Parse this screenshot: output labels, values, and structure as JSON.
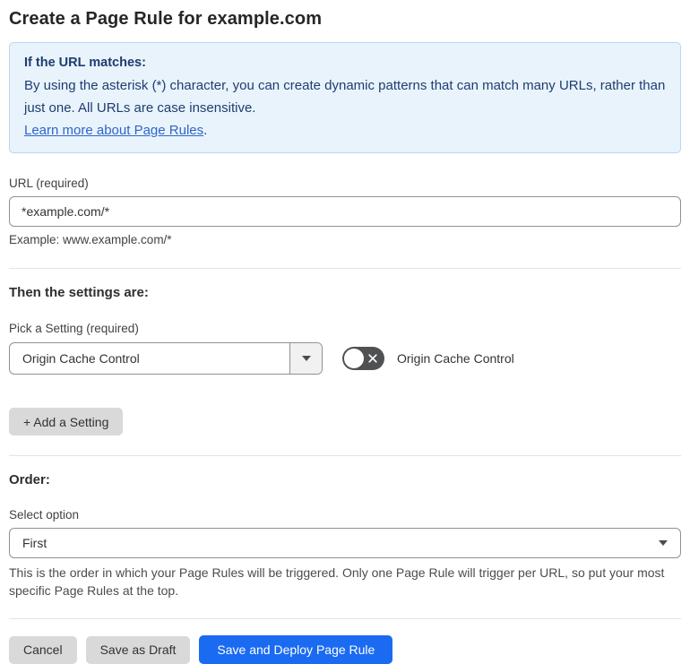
{
  "page": {
    "title": "Create a Page Rule for example.com"
  },
  "info_box": {
    "heading": "If the URL matches:",
    "body": "By using the asterisk (*) character, you can create dynamic patterns that can match many URLs, rather than just one. All URLs are case insensitive.",
    "link_label": "Learn more about Page Rules",
    "link_suffix": "."
  },
  "url_section": {
    "label": "URL (required)",
    "value": "*example.com/*",
    "example": "Example: www.example.com/*"
  },
  "settings_section": {
    "heading": "Then the settings are:",
    "picker_label": "Pick a Setting (required)",
    "picker_value": "Origin Cache Control",
    "toggle": {
      "label": "Origin Cache Control",
      "state": "off"
    },
    "add_setting_label": "+ Add a Setting"
  },
  "order_section": {
    "heading": "Order:",
    "select_label": "Select option",
    "select_value": "First",
    "helper": "This is the order in which your Page Rules will be triggered. Only one Page Rule will trigger per URL, so put your most specific Page Rules at the top."
  },
  "footer": {
    "cancel_label": "Cancel",
    "save_draft_label": "Save as Draft",
    "save_deploy_label": "Save and Deploy Page Rule"
  },
  "colors": {
    "accent_blue": "#1a6bf2",
    "info_bg": "#e9f3fc",
    "info_border": "#b5d8f4",
    "info_text": "#1e3d6f",
    "link_blue": "#2e65c9",
    "toggle_off": "#4f5152"
  }
}
